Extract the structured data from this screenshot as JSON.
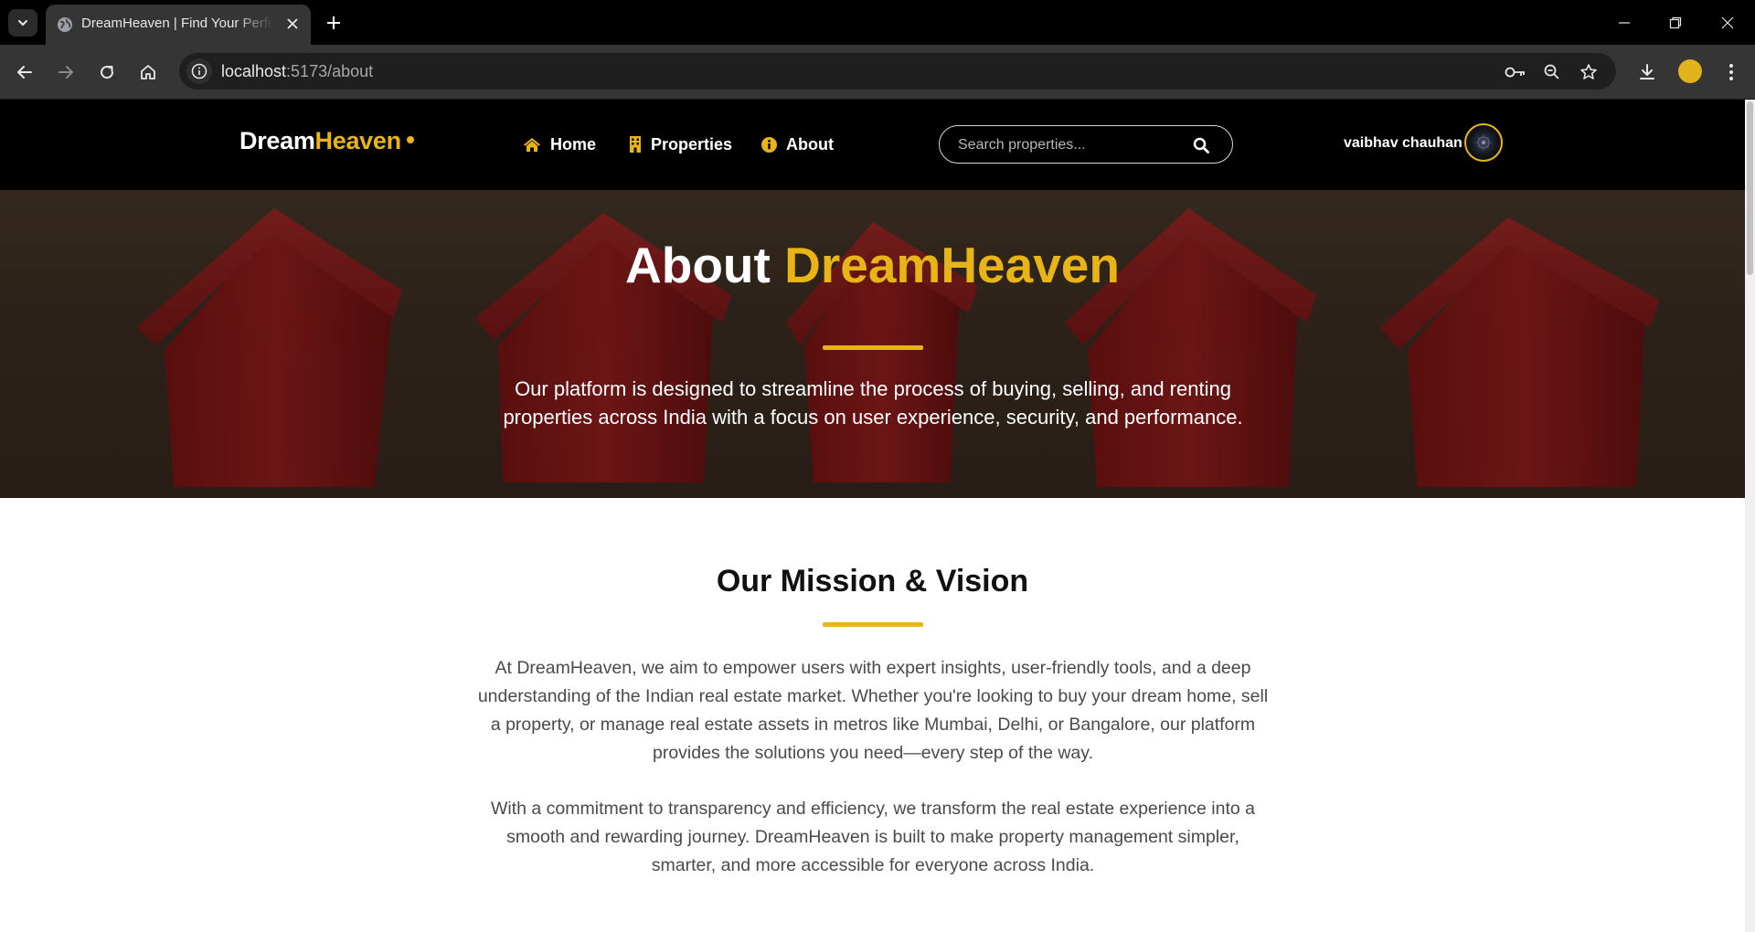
{
  "browser": {
    "tab_title": "DreamHeaven | Find Your Perfect Home",
    "url_host": "localhost",
    "url_path": ":5173/about",
    "profile_color": "#e2b31c"
  },
  "site": {
    "logo_main": "Dream",
    "logo_accent": "Heaven",
    "nav": {
      "home": "Home",
      "properties": "Properties",
      "about": "About"
    },
    "search_placeholder": "Search properties...",
    "username": "vaibhav chauhan",
    "accent_color": "#e8b416"
  },
  "hero": {
    "title_prefix": "About ",
    "title_accent": "DreamHeaven",
    "subtitle": "Our platform is designed to streamline the process of buying, selling, and renting properties across India with a focus on user experience, security, and performance."
  },
  "mission": {
    "title": "Our Mission & Vision",
    "paragraphs": [
      "At DreamHeaven, we aim to empower users with expert insights, user-friendly tools, and a deep understanding of the Indian real estate market. Whether you're looking to buy your dream home, sell a property, or manage real estate assets in metros like Mumbai, Delhi, or Bangalore, our platform provides the solutions you need—every step of the way.",
      "With a commitment to transparency and efficiency, we transform the real estate experience into a smooth and rewarding journey. DreamHeaven is built to make property management simpler, smarter, and more accessible for everyone across India."
    ]
  }
}
